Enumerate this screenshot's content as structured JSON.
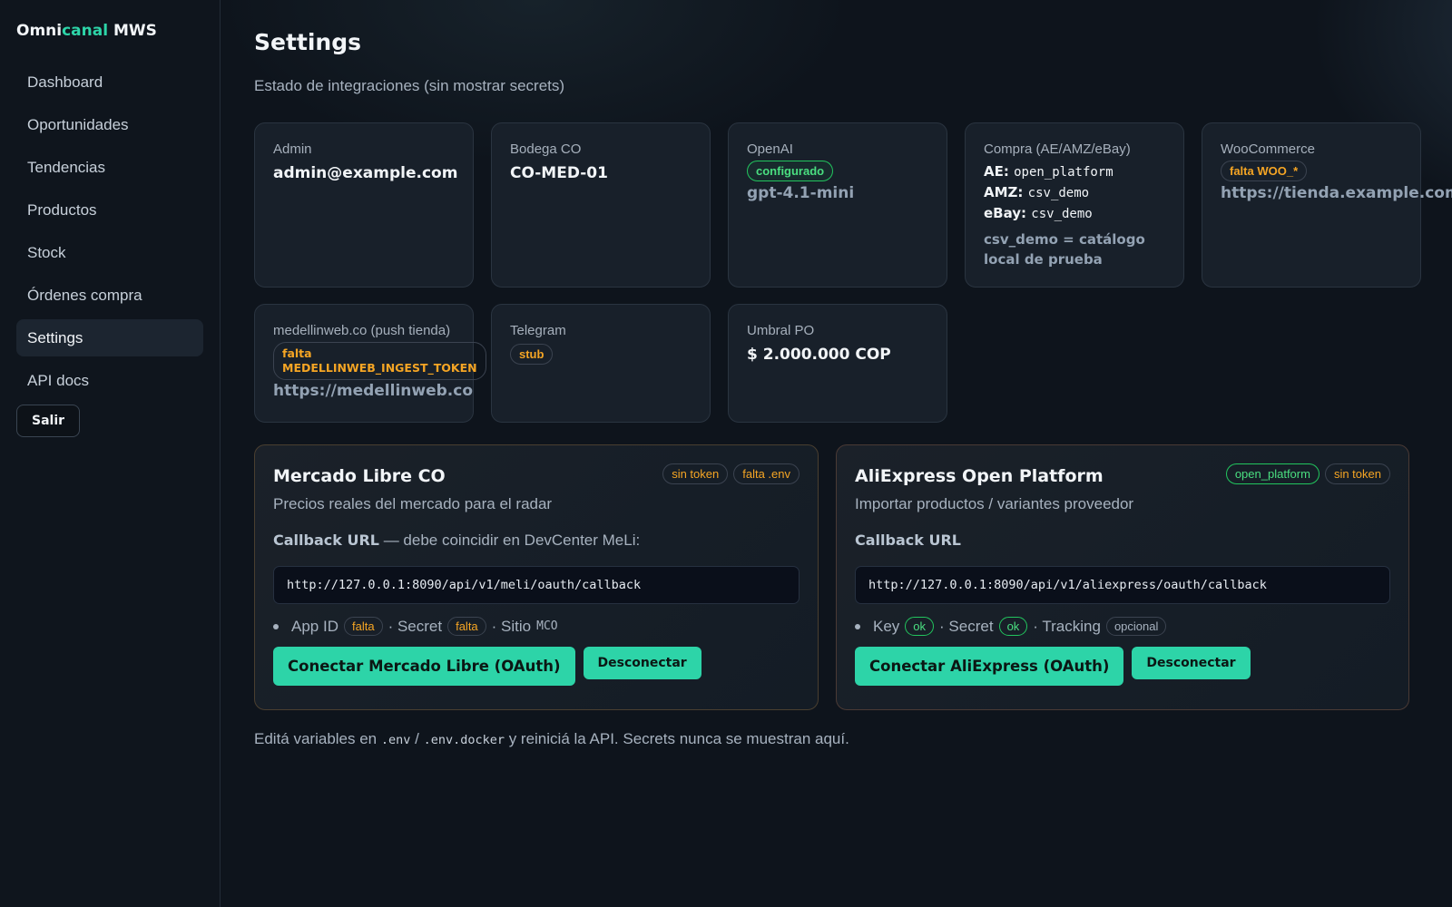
{
  "brand": {
    "part1": "Omni",
    "part2": "canal",
    "part3": " MWS"
  },
  "nav": {
    "items": [
      "Dashboard",
      "Oportunidades",
      "Tendencias",
      "Productos",
      "Stock",
      "Órdenes compra",
      "Settings",
      "API docs"
    ],
    "active": "Settings",
    "logout": "Salir"
  },
  "page": {
    "title": "Settings",
    "subtitle": "Estado de integraciones (sin mostrar secrets)"
  },
  "cards": {
    "admin": {
      "label": "Admin",
      "value": "admin@example.com"
    },
    "bodega": {
      "label": "Bodega CO",
      "value": "CO-MED-01"
    },
    "openai": {
      "label": "OpenAI",
      "badge": "configurado",
      "model": "gpt-4.1-mini"
    },
    "compra": {
      "label": "Compra (AE/AMZ/eBay)",
      "ae_key": "AE:",
      "ae_val": "open_platform",
      "amz_key": "AMZ:",
      "amz_val": "csv_demo",
      "ebay_key": "eBay:",
      "ebay_val": "csv_demo",
      "note": "csv_demo = catálogo local de prueba"
    },
    "woo": {
      "label": "WooCommerce",
      "badge": "falta WOO_*",
      "url": "https://tienda.example.com"
    },
    "medellin": {
      "label": "medellinweb.co (push tienda)",
      "badge_line1": "falta",
      "badge_line2": "MEDELLINWEB_INGEST_TOKEN",
      "url": "https://medellinweb.co"
    },
    "telegram": {
      "label": "Telegram",
      "badge": "stub"
    },
    "umbral": {
      "label": "Umbral PO",
      "value": "$ 2.000.000 COP"
    }
  },
  "meli": {
    "title": "Mercado Libre CO",
    "badges": [
      "sin token",
      "falta .env"
    ],
    "desc": "Precios reales del mercado para el radar",
    "callback_label": "Callback URL",
    "callback_suffix": " — debe coincidir en DevCenter MeLi:",
    "callback_url": "http://127.0.0.1:8090/api/v1/meli/oauth/callback",
    "status": {
      "app_id": "App ID",
      "app_id_badge": "falta",
      "secret": "· Secret",
      "secret_badge": "falta",
      "site": "· Sitio",
      "site_code": "MCO"
    },
    "connect": "Conectar Mercado Libre (OAuth)",
    "disconnect": "Desconectar"
  },
  "ali": {
    "title": "AliExpress Open Platform",
    "badges": [
      "open_platform",
      "sin token"
    ],
    "desc": "Importar productos / variantes proveedor",
    "callback_label": "Callback URL",
    "callback_url": "http://127.0.0.1:8090/api/v1/aliexpress/oauth/callback",
    "status": {
      "key": "Key",
      "key_badge": "ok",
      "secret": "· Secret",
      "secret_badge": "ok",
      "tracking": "· Tracking",
      "tracking_badge": "opcional"
    },
    "connect": "Conectar AliExpress (OAuth)",
    "disconnect": "Desconectar"
  },
  "footer": {
    "p1": "Editá variables en ",
    "env1": ".env",
    "sep": " / ",
    "env2": ".env.docker",
    "p2": " y reiniciá la API. Secrets nunca se muestran aquí."
  },
  "colors": {
    "accent": "#2dd4a8",
    "warning": "#f5a524",
    "ok": "#4ade80",
    "background": "#0e141c"
  }
}
